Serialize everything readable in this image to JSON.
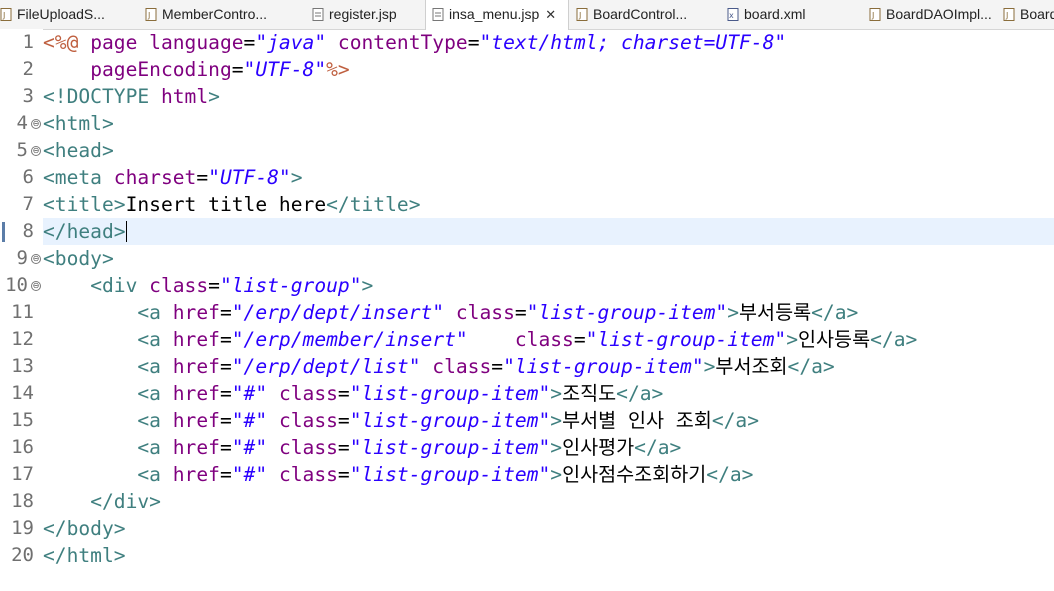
{
  "editor_tabs": [
    {
      "label": "FileUploadS...",
      "active": false,
      "icon": "java-file-icon"
    },
    {
      "label": "MemberContro...",
      "active": false,
      "icon": "java-file-icon"
    },
    {
      "label": "register.jsp",
      "active": false,
      "icon": "jsp-file-icon"
    },
    {
      "label": "insa_menu.jsp",
      "active": true,
      "icon": "jsp-file-icon",
      "close": "✕"
    },
    {
      "label": "BoardControl...",
      "active": false,
      "icon": "java-file-icon"
    },
    {
      "label": "board.xml",
      "active": false,
      "icon": "xml-file-icon"
    },
    {
      "label": "BoardDAOImpl...",
      "active": false,
      "icon": "java-file-icon"
    },
    {
      "label": "Board",
      "active": false,
      "icon": "java-file-icon"
    }
  ],
  "line_numbers": [
    "1",
    "2",
    "3",
    "4",
    "5",
    "6",
    "7",
    "8",
    "9",
    "10",
    "11",
    "12",
    "13",
    "14",
    "15",
    "16",
    "17",
    "18",
    "19",
    "20"
  ],
  "folded_lines": [
    "4",
    "5",
    "9",
    "10"
  ],
  "current_line": "8",
  "code": {
    "l1": [
      "<%@",
      " ",
      "page",
      " ",
      "language",
      "=",
      "\"java\"",
      " ",
      "contentType",
      "=",
      "\"text/html; charset=UTF-8\""
    ],
    "l2": [
      "    ",
      "pageEncoding",
      "=",
      "\"UTF-8\"",
      "%>"
    ],
    "l3": [
      "<!DOCTYPE",
      " ",
      "html",
      ">"
    ],
    "l4": [
      "<html>"
    ],
    "l5": [
      "<head>"
    ],
    "l6": [
      "<meta",
      " ",
      "charset",
      "=",
      "\"UTF-8\"",
      ">"
    ],
    "l7": [
      "<title>",
      "Insert title here",
      "</title>"
    ],
    "l8": [
      "</head>"
    ],
    "l9": [
      "<body>"
    ],
    "l10": [
      "    ",
      "<div",
      " ",
      "class",
      "=",
      "\"list-group\"",
      ">"
    ],
    "l11": [
      "        ",
      "<a",
      " ",
      "href",
      "=",
      "\"/erp/dept/insert\"",
      " ",
      "class",
      "=",
      "\"list-group-item\"",
      ">",
      "부서등록",
      "</a>"
    ],
    "l12": [
      "        ",
      "<a",
      " ",
      "href",
      "=",
      "\"/erp/member/insert\"",
      "    ",
      "class",
      "=",
      "\"list-group-item\"",
      ">",
      "인사등록",
      "</a>"
    ],
    "l13": [
      "        ",
      "<a",
      " ",
      "href",
      "=",
      "\"/erp/dept/list\"",
      " ",
      "class",
      "=",
      "\"list-group-item\"",
      ">",
      "부서조회",
      "</a>"
    ],
    "l14": [
      "        ",
      "<a",
      " ",
      "href",
      "=",
      "\"#\"",
      " ",
      "class",
      "=",
      "\"list-group-item\"",
      ">",
      "조직도",
      "</a>"
    ],
    "l15": [
      "        ",
      "<a",
      " ",
      "href",
      "=",
      "\"#\"",
      " ",
      "class",
      "=",
      "\"list-group-item\"",
      ">",
      "부서별 인사 조회",
      "</a>"
    ],
    "l16": [
      "        ",
      "<a",
      " ",
      "href",
      "=",
      "\"#\"",
      " ",
      "class",
      "=",
      "\"list-group-item\"",
      ">",
      "인사평가",
      "</a>"
    ],
    "l17": [
      "        ",
      "<a",
      " ",
      "href",
      "=",
      "\"#\"",
      " ",
      "class",
      "=",
      "\"list-group-item\"",
      ">",
      "인사점수조회하기",
      "</a>"
    ],
    "l18": [
      "    ",
      "</div>"
    ],
    "l19": [
      "</body>"
    ],
    "l20": [
      "</html>"
    ]
  },
  "colors": {
    "tag": "#3f7f7f",
    "attribute": "#7f007f",
    "value": "#2a00ff",
    "directive": "#bf5f3f",
    "current_line_bg": "#e8f2fe"
  }
}
